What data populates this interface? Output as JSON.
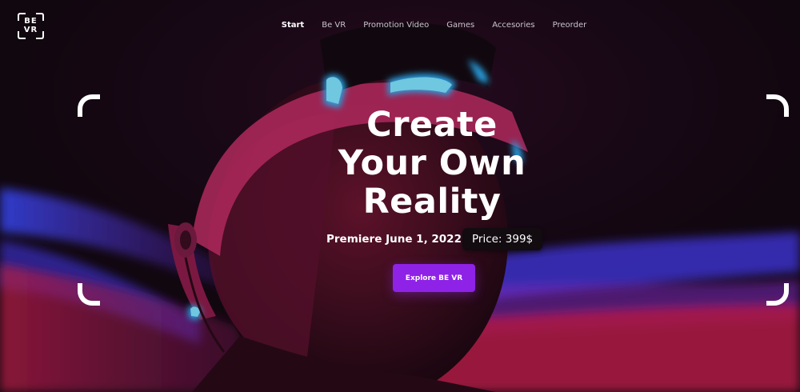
{
  "logo": {
    "text": "BE\nVR"
  },
  "nav": {
    "items": [
      {
        "label": "Start",
        "active": true
      },
      {
        "label": "Be VR"
      },
      {
        "label": "Promotion Video"
      },
      {
        "label": "Games"
      },
      {
        "label": "Accesories"
      },
      {
        "label": "Preorder"
      }
    ]
  },
  "hero": {
    "headline_line1": "Create",
    "headline_line2": "Your Own",
    "headline_line3": "Reality",
    "premiere": "Premiere June 1, 2022",
    "price": "Price: 399$",
    "cta_label": "Explore BE VR"
  },
  "colors": {
    "accent": "#8e22e6",
    "background": "#1a0b1c",
    "neon_blue": "#2fb6ff",
    "neon_pink": "#d22a6a"
  }
}
